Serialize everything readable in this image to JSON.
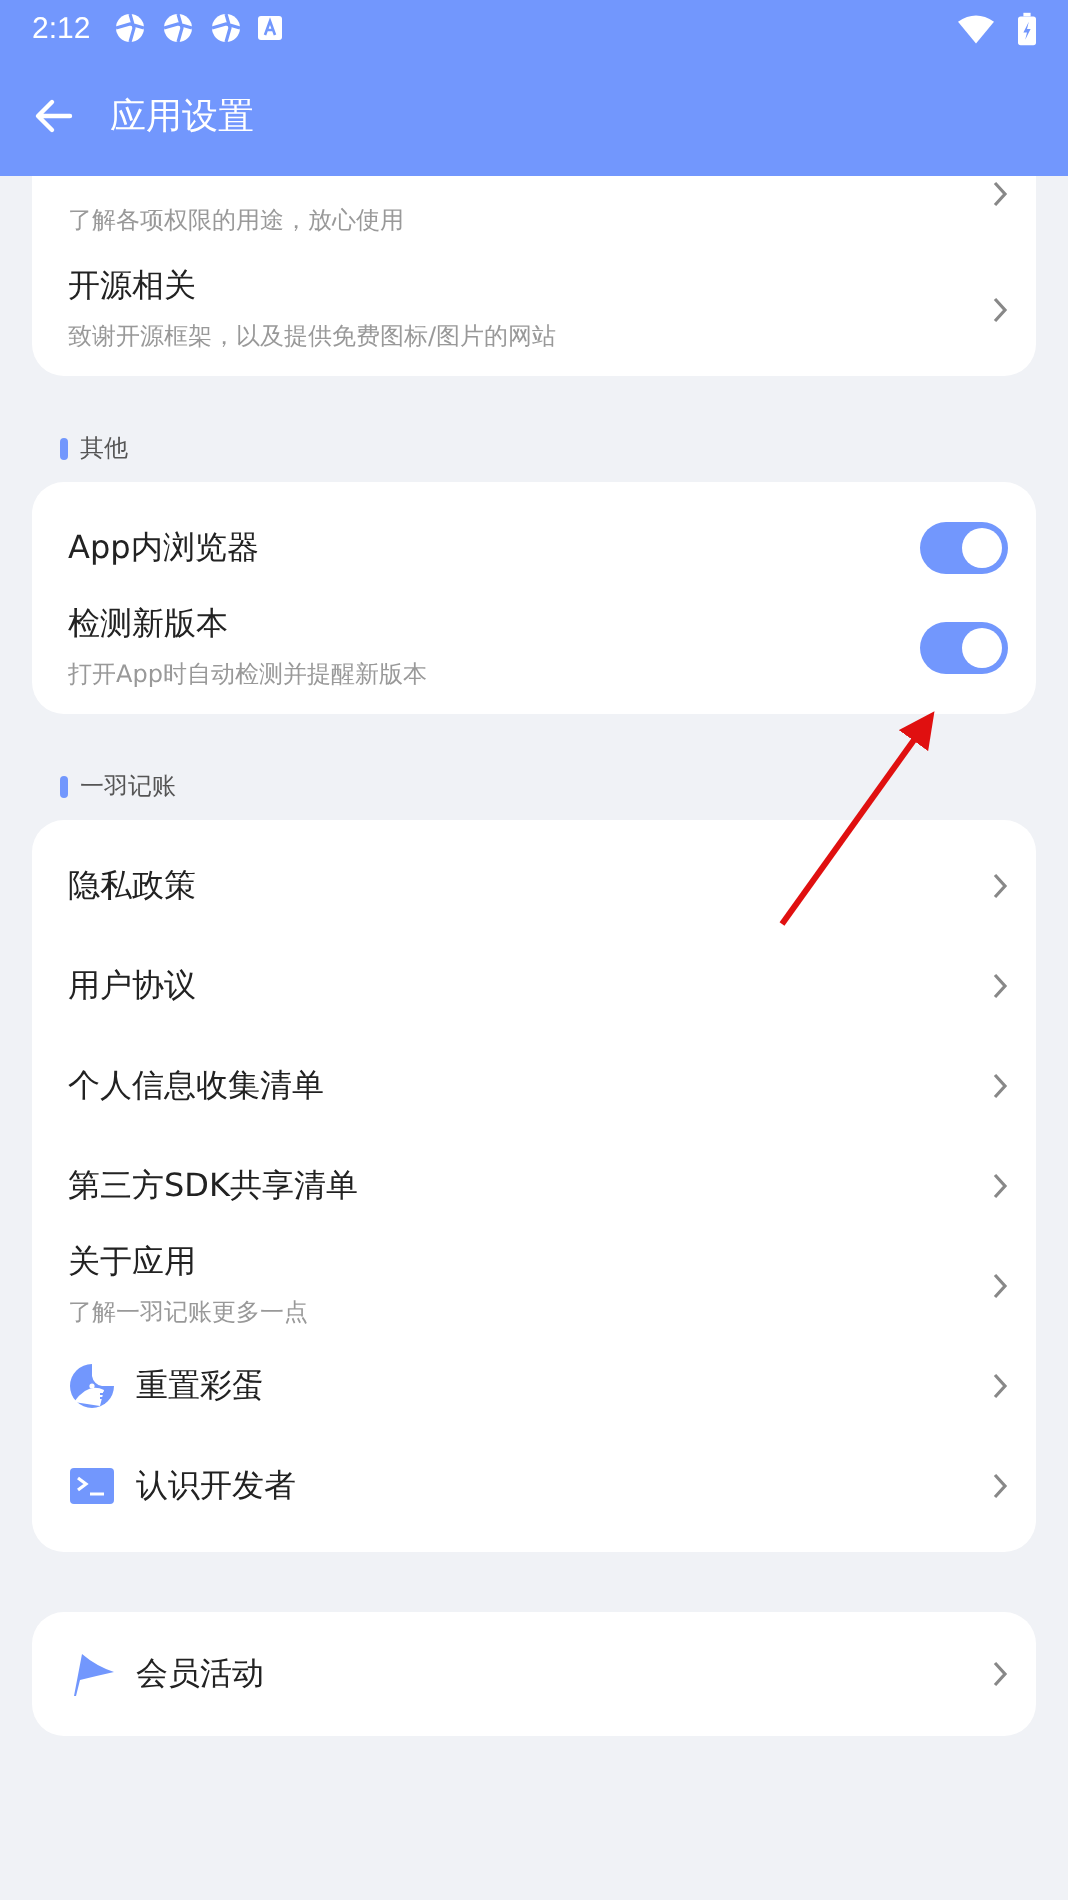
{
  "status_bar": {
    "time": "2:12"
  },
  "app_bar": {
    "title": "应用设置"
  },
  "sections": [
    {
      "items": [
        {
          "kind": "link",
          "subtitle": "了解各项权限的用途，放心使用"
        },
        {
          "kind": "link",
          "title": "开源相关",
          "subtitle": "致谢开源框架，以及提供免费图标/图片的网站"
        }
      ]
    },
    {
      "label": "其他",
      "items": [
        {
          "kind": "toggle",
          "title": "App内浏览器",
          "on": true
        },
        {
          "kind": "toggle",
          "title": "检测新版本",
          "subtitle": "打开App时自动检测并提醒新版本",
          "on": true
        }
      ]
    },
    {
      "label": "一羽记账",
      "items": [
        {
          "kind": "link",
          "title": "隐私政策"
        },
        {
          "kind": "link",
          "title": "用户协议"
        },
        {
          "kind": "link",
          "title": "个人信息收集清单"
        },
        {
          "kind": "link",
          "title": "第三方SDK共享清单"
        },
        {
          "kind": "link",
          "title": "关于应用",
          "subtitle": "了解一羽记账更多一点"
        },
        {
          "kind": "bird",
          "title": "重置彩蛋"
        },
        {
          "kind": "terminal",
          "title": "认识开发者"
        }
      ]
    },
    {
      "items": [
        {
          "kind": "flag",
          "title": "会员活动"
        }
      ]
    }
  ]
}
